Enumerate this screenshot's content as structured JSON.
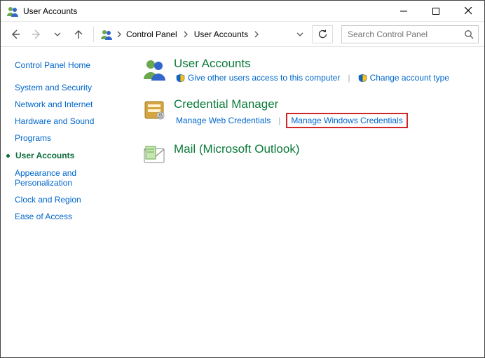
{
  "window": {
    "title": "User Accounts"
  },
  "breadcrumb": {
    "c1": "Control Panel",
    "c2": "User Accounts"
  },
  "search": {
    "placeholder": "Search Control Panel"
  },
  "sidebar": {
    "home": "Control Panel Home",
    "items": {
      "l0": "System and Security",
      "l1": "Network and Internet",
      "l2": "Hardware and Sound",
      "l3": "Programs",
      "current": "User Accounts",
      "l5": "Appearance and Personalization",
      "l6": "Clock and Region",
      "l7": "Ease of Access"
    }
  },
  "categories": {
    "user_accounts": {
      "title": "User Accounts",
      "give_access": "Give other users access to this computer",
      "change_type": "Change account type"
    },
    "credential_manager": {
      "title": "Credential Manager",
      "manage_web": "Manage Web Credentials",
      "manage_windows": "Manage Windows Credentials"
    },
    "mail": {
      "title": "Mail (Microsoft Outlook)"
    }
  }
}
